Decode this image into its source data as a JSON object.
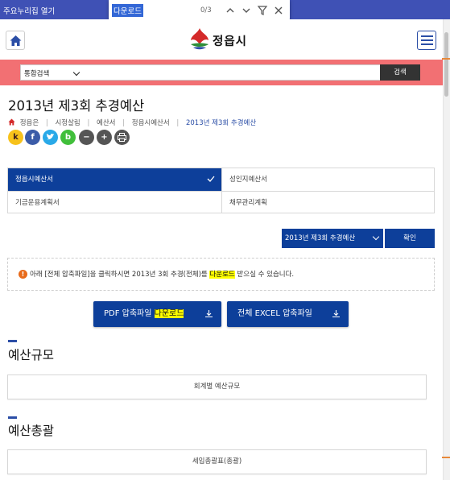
{
  "browser": {
    "bookmarks_label": "주요누리집 열기",
    "find": {
      "query": "다운로드",
      "count": "0/3"
    }
  },
  "header": {
    "logo_text": "정읍시"
  },
  "search": {
    "scope": "통합검색",
    "button": "검색"
  },
  "page": {
    "title": "2013년 제3회 추경예산"
  },
  "breadcrumb": [
    "정읍은",
    "시정살림",
    "예산서",
    "정읍시예산서",
    "2013년 제3회 추경예산"
  ],
  "share": [
    {
      "name": "kakaostory",
      "letter": "k",
      "color": "#f7c21b"
    },
    {
      "name": "facebook",
      "letter": "f",
      "color": "#3b5ca8"
    },
    {
      "name": "twitter",
      "letter": "t",
      "color": "#29a9e8"
    },
    {
      "name": "band",
      "letter": "b",
      "color": "#41bf3b"
    },
    {
      "name": "zoom-out",
      "letter": "−",
      "color": "#555555"
    },
    {
      "name": "zoom-in",
      "letter": "+",
      "color": "#555555"
    },
    {
      "name": "print",
      "letter": "",
      "color": "#555555"
    }
  ],
  "tabs": [
    {
      "label": "정읍시예산서",
      "active": true
    },
    {
      "label": "성인지예산서",
      "active": false
    },
    {
      "label": "기금운용계획서",
      "active": false
    },
    {
      "label": "채무관리계획",
      "active": false
    }
  ],
  "year_select": {
    "value": "2013년 제3회 추경예산",
    "confirm": "확인"
  },
  "notice": {
    "before": "아래 [전체 압축파일]을 클릭하시면 2013년 3회 추경(전체)를 ",
    "highlight": "다운로드",
    "after": " 받으실 수 있습니다."
  },
  "downloads": {
    "pdf_prefix": "PDF 압축파일 ",
    "pdf_highlight": "다운로드",
    "excel": "전체 EXCEL 압축파일"
  },
  "sections": [
    {
      "title": "예산규모",
      "item": "회계별 예산규모"
    },
    {
      "title": "예산총괄",
      "item": "세입총괄표(총괄)"
    }
  ],
  "colors": {
    "brand_blue": "#0d3f9a",
    "search_band": "#f27073",
    "browser_bar": "#3f51b5"
  }
}
